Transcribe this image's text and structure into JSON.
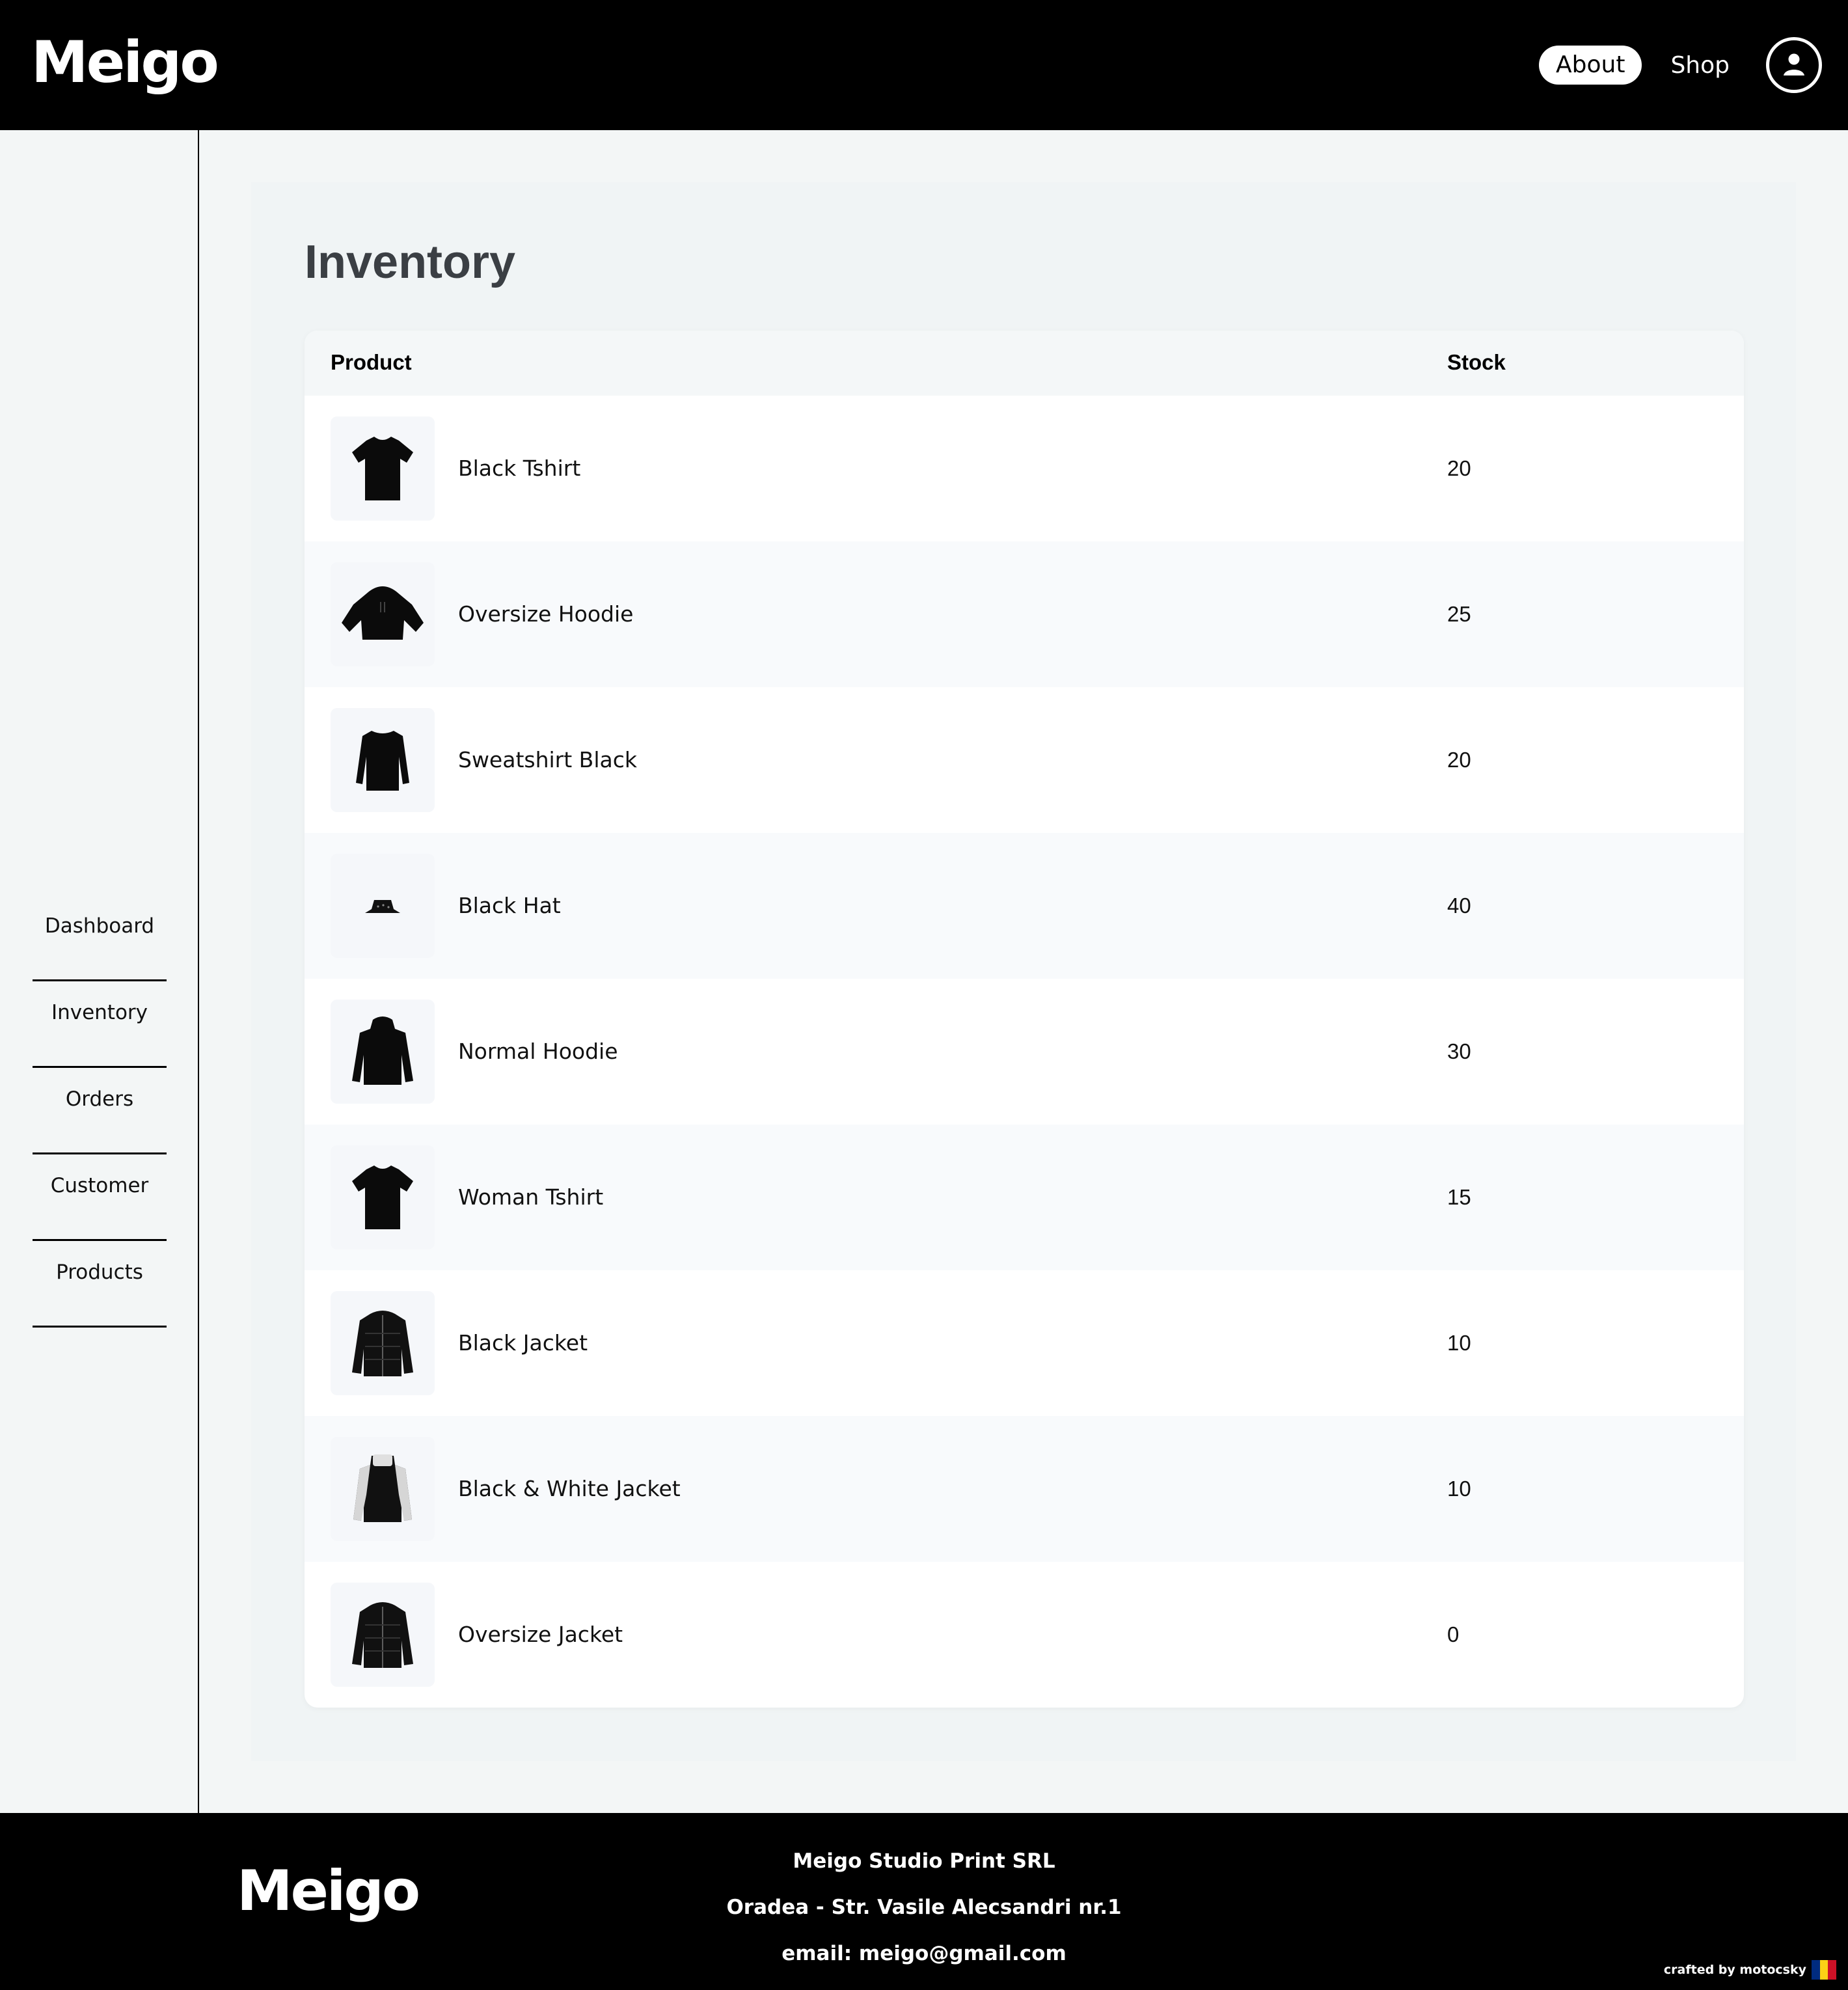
{
  "header": {
    "logo": "Meigo",
    "nav": {
      "about": "About",
      "shop": "Shop"
    },
    "user_icon": "user-circle-icon"
  },
  "sidebar": {
    "items": [
      {
        "label": "Dashboard"
      },
      {
        "label": "Inventory"
      },
      {
        "label": "Orders"
      },
      {
        "label": "Customer"
      },
      {
        "label": "Products"
      }
    ]
  },
  "main": {
    "title": "Inventory",
    "columns": {
      "product": "Product",
      "stock": "Stock"
    },
    "rows": [
      {
        "product": "Black Tshirt",
        "stock": "20",
        "image": "tshirt"
      },
      {
        "product": "Oversize Hoodie",
        "stock": "25",
        "image": "oversize-hoodie"
      },
      {
        "product": "Sweatshirt Black",
        "stock": "20",
        "image": "sweatshirt"
      },
      {
        "product": "Black Hat",
        "stock": "40",
        "image": "bucket-hat"
      },
      {
        "product": "Normal Hoodie",
        "stock": "30",
        "image": "hoodie"
      },
      {
        "product": "Woman Tshirt",
        "stock": "15",
        "image": "tshirt"
      },
      {
        "product": "Black Jacket",
        "stock": "10",
        "image": "puffer-jacket"
      },
      {
        "product": "Black & White Jacket",
        "stock": "10",
        "image": "bw-jacket"
      },
      {
        "product": "Oversize Jacket",
        "stock": "0",
        "image": "puffer-jacket"
      }
    ]
  },
  "footer": {
    "logo": "Meigo",
    "company": "Meigo Studio Print SRL",
    "address": "Oradea - Str. Vasile Alecsandri nr.1",
    "email": "email: meigo@gmail.com",
    "crafted": "crafted by motocsky",
    "flag_colors": [
      "#002b7f",
      "#fcd116",
      "#ce1126"
    ]
  },
  "colors": {
    "header_bg": "#000000",
    "page_bg": "#f3f6f6",
    "table_bg": "#ffffff",
    "row_alt_bg": "#f8fafc",
    "title_color": "#3b3f44"
  }
}
